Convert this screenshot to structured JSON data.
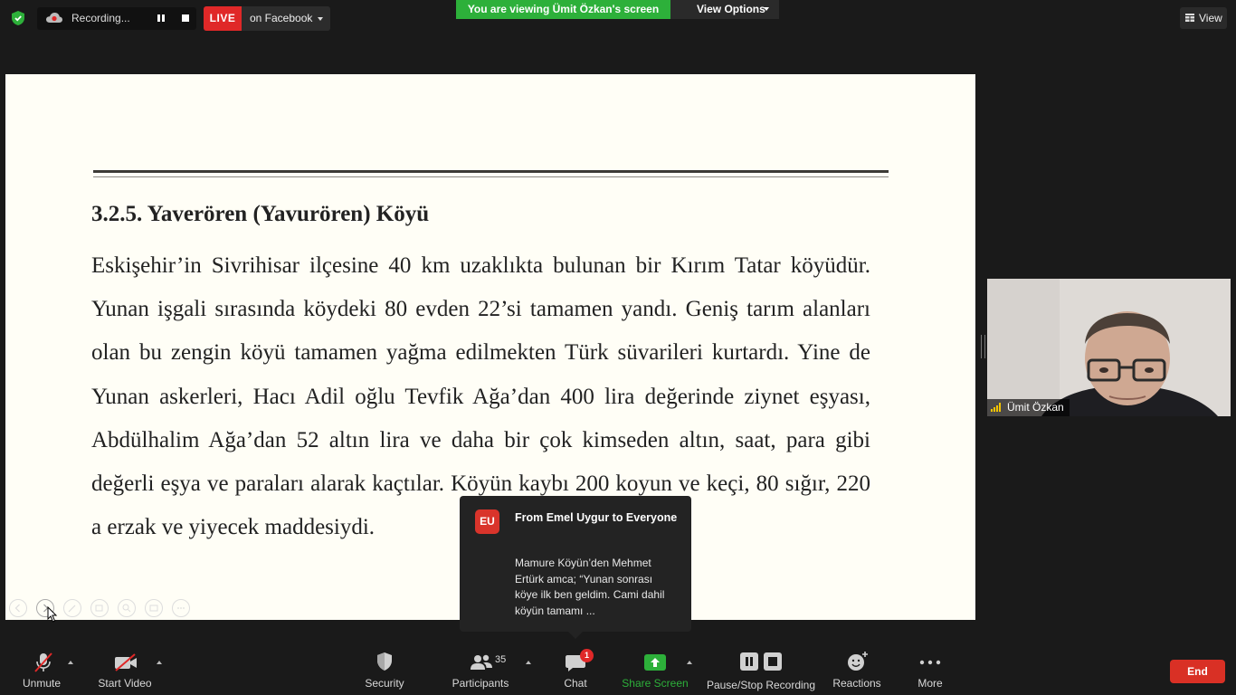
{
  "topbar": {
    "recording_label": "Recording...",
    "live_badge": "LIVE",
    "live_target": "on Facebook",
    "viewing_banner": "You are viewing Ümit Özkan's screen",
    "view_options_label": "View Options",
    "view_button_label": "View",
    "colors": {
      "live": "#e02828",
      "viewing": "#2db03a"
    }
  },
  "slide": {
    "heading": "3.2.5. Yaverören (Yavurören) Köyü",
    "paragraph": "Eskişehir’in Sivrihisar ilçesine  40 km uzaklıkta bulunan bir Kırım Tatar köyüdür. Yunan işgali sırasında köydeki 80 evden 22’si tamamen yandı. Geniş tarım alanları olan bu zengin köyü tamamen yağma edilmekten Türk süvarileri kurtardı. Yine de Yunan askerleri, Hacı Adil oğlu Tevfik Ağa’dan 400 lira değerinde ziynet eşyası,  Abdülhalim Ağa’dan 52 altın lira ve daha bir çok kimseden altın, saat, para gibi değerli eşya ve paraları alarak kaçtılar. Köyün kaybı 200 koyun ve keçi, 80 sığır, 220 a erzak ve yiyecek maddesiydi.",
    "tools": [
      "prev-icon",
      "next-icon",
      "pen-icon",
      "copy-icon",
      "zoom-icon",
      "subtitle-icon",
      "more-icon"
    ]
  },
  "participant": {
    "name": "Ümit Özkan"
  },
  "chat_popup": {
    "avatar_initials": "EU",
    "title": "From Emel Uygur to Everyone",
    "message": "Mamure Köyün’den Mehmet Ertürk amca; “Yunan sonrası köye ilk ben geldim. Cami dahil köyün tamamı ..."
  },
  "toolbar": {
    "unmute": "Unmute",
    "start_video": "Start Video",
    "security": "Security",
    "participants": "Participants",
    "participants_count": "35",
    "chat": "Chat",
    "chat_badge": "1",
    "share_screen": "Share Screen",
    "pause_stop_recording": "Pause/Stop Recording",
    "reactions": "Reactions",
    "more": "More",
    "end": "End",
    "colors": {
      "share": "#2db03a",
      "end": "#d93025"
    }
  }
}
